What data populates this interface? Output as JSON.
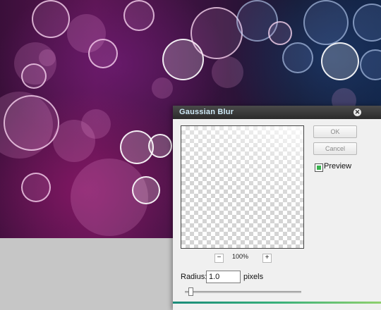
{
  "dialog": {
    "title": "Gaussian Blur",
    "close_symbol": "✕",
    "ok_label": "OK",
    "cancel_label": "Cancel",
    "preview_label": "Preview",
    "preview_checked": true,
    "zoom_out_label": "−",
    "zoom_in_label": "+",
    "zoom_level": "100%",
    "radius_label": "Radius:",
    "radius_value": "1.0",
    "radius_units": "pixels",
    "radius_slider_fraction": 0.05
  },
  "colors": {
    "title_bar": "#2b2b2b",
    "title_text": "#cde9f7",
    "accent_start": "#1b8c7a",
    "accent_end": "#8fd06e",
    "checkbox_tick": "#37b24d",
    "workspace_gray": "#c6c6c6"
  },
  "icons": {
    "close": "close-icon",
    "checkbox": "checkbox-checked-icon"
  }
}
